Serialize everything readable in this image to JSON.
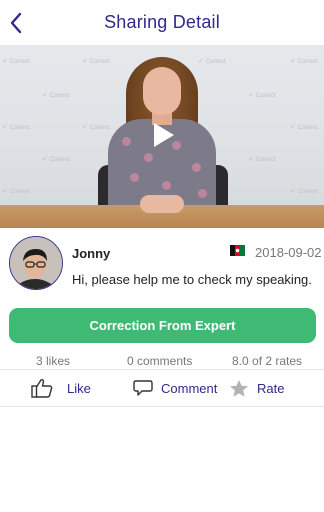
{
  "header": {
    "title": "Sharing Detail",
    "back_icon": "chevron-left-icon",
    "accent_color": "#2e2a8e"
  },
  "video": {
    "watermark_text": "Correct",
    "play_icon": "play-icon"
  },
  "post": {
    "author": "Jonny",
    "date": "2018-09-02",
    "message": "Hi, please help me to check my speaking.",
    "flag_icon": "flag-icon"
  },
  "correction_button": {
    "label": "Correction From Expert",
    "color": "#3fba74"
  },
  "stats": {
    "likes": "3 likes",
    "comments": "0 comments",
    "rates": "8.0 of 2 rates"
  },
  "actions": {
    "like_label": "Like",
    "comment_label": "Comment",
    "rate_label": "Rate"
  }
}
